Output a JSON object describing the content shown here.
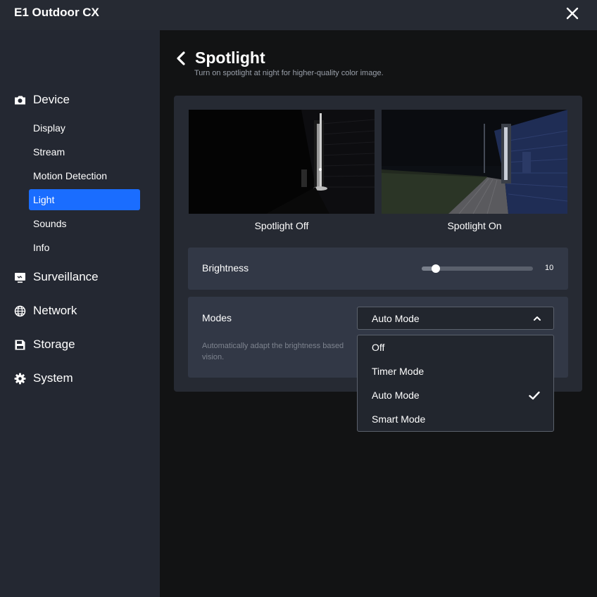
{
  "window": {
    "title": "E1 Outdoor CX"
  },
  "sidebar": {
    "sections": [
      {
        "label": "Device",
        "icon": "camera-icon"
      },
      {
        "label": "Surveillance",
        "icon": "monitor-icon"
      },
      {
        "label": "Network",
        "icon": "globe-icon"
      },
      {
        "label": "Storage",
        "icon": "storage-icon"
      },
      {
        "label": "System",
        "icon": "gear-icon"
      }
    ],
    "device_items": [
      {
        "label": "Display"
      },
      {
        "label": "Stream"
      },
      {
        "label": "Motion Detection"
      },
      {
        "label": "Light",
        "active": true
      },
      {
        "label": "Sounds"
      },
      {
        "label": "Info"
      }
    ]
  },
  "page": {
    "title": "Spotlight",
    "subtitle": "Turn on spotlight at night for higher-quality color image."
  },
  "previews": [
    {
      "caption": "Spotlight Off"
    },
    {
      "caption": "Spotlight On"
    }
  ],
  "brightness": {
    "label": "Brightness",
    "value": "10",
    "fraction": 0.12
  },
  "modes": {
    "label": "Modes",
    "selected": "Auto Mode",
    "description": "Automatically adapt the brightness based",
    "description_cont": "vision.",
    "options": [
      "Off",
      "Timer Mode",
      "Auto Mode",
      "Smart Mode"
    ]
  },
  "colors": {
    "accent": "#1a6dff",
    "background": "#121314",
    "sidebar": "#242832",
    "panel": "#323846"
  }
}
